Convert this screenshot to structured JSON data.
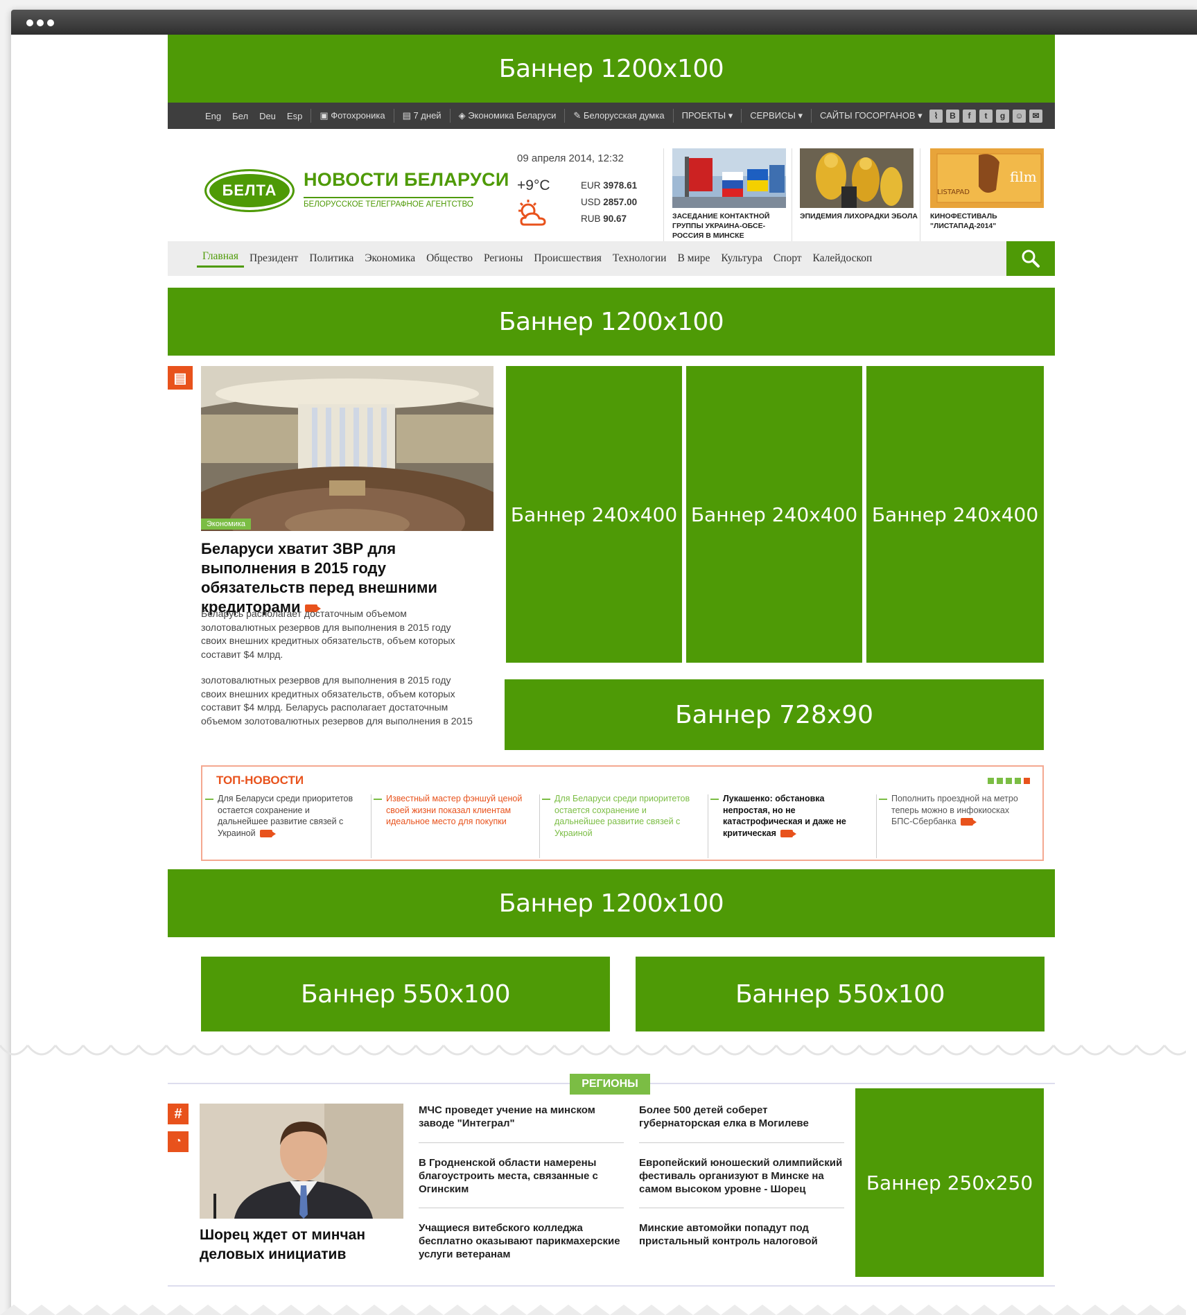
{
  "banners": {
    "top": "Баннер 1200х100",
    "mid1": "Баннер 1200х100",
    "tall1": "Баннер 240х400",
    "tall2": "Баннер 240х400",
    "tall3": "Баннер 240х400",
    "leader": "Баннер 728х90",
    "mid2": "Баннер 1200х100",
    "half1": "Баннер 550х100",
    "half2": "Баннер 550х100",
    "square": "Баннер 250х250"
  },
  "topbar": {
    "langs": [
      "Eng",
      "Бел",
      "Deu",
      "Esp"
    ],
    "links": [
      "Фотохроника",
      "7 дней",
      "Экономика Беларуси",
      "Белорусская думка"
    ],
    "menus": [
      "ПРОЕКТЫ ▾",
      "СЕРВИСЫ ▾",
      "САЙТЫ ГОСОРГАНОВ ▾"
    ],
    "social": [
      "rss",
      "В",
      "f",
      "t",
      "g+",
      "ok",
      "m"
    ]
  },
  "header": {
    "logo_text": "БЕЛТА",
    "title": "НОВОСТИ БЕЛАРУСИ",
    "subtitle": "БЕЛОРУССКОЕ ТЕЛЕГРАФНОЕ АГЕНТСТВО",
    "date": "09 апреля 2014, 12:32",
    "temperature": "+9°C",
    "rates": [
      {
        "label": "EUR",
        "value": "3978.61"
      },
      {
        "label": "USD",
        "value": "2857.00"
      },
      {
        "label": "RUB",
        "value": "90.67"
      }
    ],
    "thumbs": [
      {
        "caption": "ЗАСЕДАНИЕ КОНТАКТНОЙ ГРУППЫ УКРАИНА-ОБСЕ-РОССИЯ В МИНСКЕ"
      },
      {
        "caption": "ЭПИДЕМИЯ ЛИХОРАДКИ ЭБОЛА"
      },
      {
        "caption": "КИНОФЕСТИВАЛЬ \"ЛИСТАПАД-2014\""
      }
    ]
  },
  "nav": [
    "Главная",
    "Президент",
    "Политика",
    "Экономика",
    "Общество",
    "Регионы",
    "Происшествия",
    "Технологии",
    "В мире",
    "Культура",
    "Спорт",
    "Калейдоскоп"
  ],
  "lead": {
    "tag": "Экономика",
    "headline": "Беларуси хватит ЗВР для выполнения в 2015 году обязательств перед внешними кредиторами",
    "para1": "Беларусь располагает достаточным объемом золотовалютных резервов для выполнения в 2015 году своих внешних кредитных обязательств, объем которых составит $4 млрд.",
    "para2": "золотовалютных резервов для выполнения в 2015 году своих внешних кредитных обязательств, объем которых составит $4 млрд. Беларусь располагает достаточным объемом золотовалютных резервов для выполнения в 2015"
  },
  "topnews": {
    "title": "ТОП-НОВОСТИ",
    "items": [
      "Для Беларуси среди приоритетов остается сохранение и дальнейшее развитие связей с Украиной",
      "Известный мастер фэншуй ценой своей жизни показал клиентам идеальное место для покупки",
      "Для Беларуси среди приоритетов остается сохранение и дальнейшее развитие связей с Украиной",
      "Лукашенко: обстановка непростая, но не катастрофическая и даже не критическая",
      "Пополнить проездной на метро теперь можно в инфокиосках БПС-Сбербанка"
    ]
  },
  "regions": {
    "tag": "РЕГИОНЫ",
    "main_headline": "Шорец ждет от минчан деловых инициатив",
    "col1": [
      "МЧС проведет учение на минском заводе \"Интеграл\"",
      "В Гродненской области намерены благоустроить места, связанные с Огинским",
      "Учащиеся витебского колледжа бесплатно оказывают парикмахерские услуги ветеранам"
    ],
    "col2": [
      "Более 500 детей соберет губернаторская елка в Могилеве",
      "Европейский юношеский олимпийский фестиваль организуют в Минске на самом высоком уровне - Шорец",
      "Минские автомойки попадут под пристальный контроль налоговой"
    ]
  },
  "colors": {
    "green": "#4e9a06",
    "light_green": "#7bbd44",
    "orange": "#e8521c"
  }
}
